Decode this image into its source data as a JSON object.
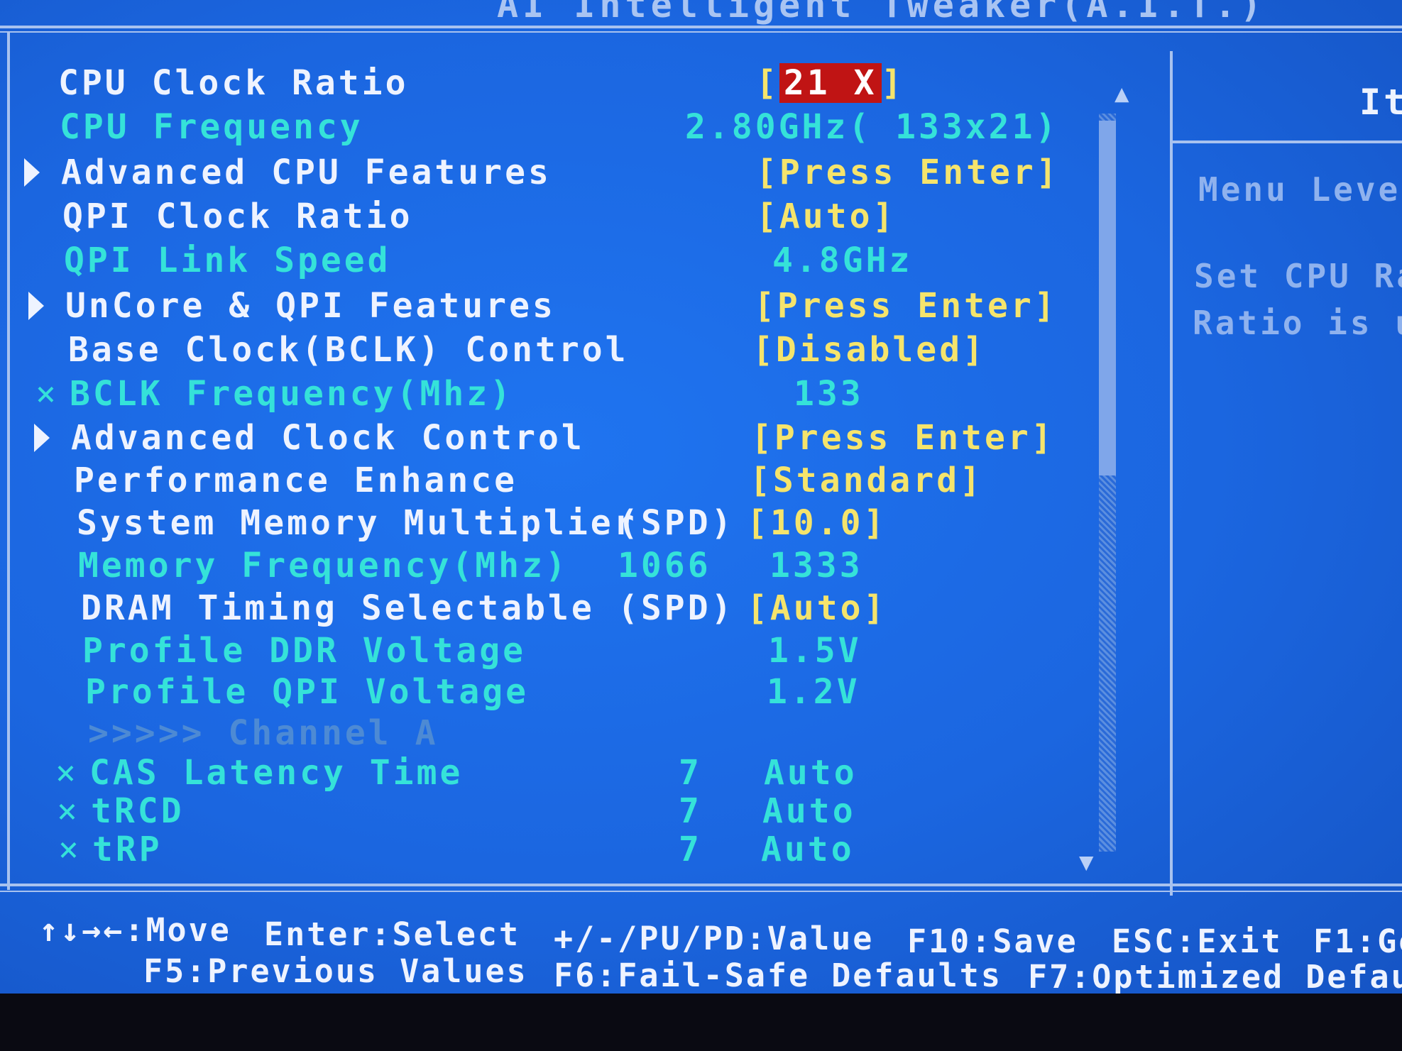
{
  "title": "AI Intelligent Tweaker(A.I.T.)",
  "settings": [
    {
      "label": "CPU Clock Ratio",
      "value": "21 X",
      "type": "selected"
    },
    {
      "label": "CPU Frequency",
      "value": "2.80GHz( 133x21)",
      "type": "info"
    },
    {
      "label": "Advanced CPU Features",
      "value": "[Press Enter]",
      "type": "submenu"
    },
    {
      "label": "QPI Clock Ratio",
      "value": "[Auto]",
      "type": "option"
    },
    {
      "label": "QPI Link Speed",
      "value": "4.8GHz",
      "type": "info"
    },
    {
      "label": "UnCore & QPI Features",
      "value": "[Press Enter]",
      "type": "submenu"
    },
    {
      "label": "Base Clock(BCLK) Control",
      "value": "[Disabled]",
      "type": "option"
    },
    {
      "label": "BCLK Frequency(Mhz)",
      "value": "133",
      "type": "disabled"
    },
    {
      "label": "Advanced Clock Control",
      "value": "[Press Enter]",
      "type": "submenu"
    },
    {
      "label": "Performance Enhance",
      "value": "[Standard]",
      "type": "option"
    },
    {
      "label": "System Memory Multiplier",
      "mid": "(SPD)",
      "value": "[10.0]",
      "type": "option"
    },
    {
      "label": "Memory Frequency(Mhz)",
      "mid": "1066",
      "value": "1333",
      "type": "info"
    },
    {
      "label": "DRAM Timing Selectable",
      "mid": "(SPD)",
      "value": "[Auto]",
      "type": "option"
    },
    {
      "label": "Profile DDR Voltage",
      "value": "1.5V",
      "type": "info"
    },
    {
      "label": "Profile QPI Voltage",
      "value": "1.2V",
      "type": "info"
    },
    {
      "label": ">>>>> Channel A",
      "value": "",
      "type": "header"
    },
    {
      "label": "CAS Latency Time",
      "mid": "7",
      "value": "Auto",
      "type": "disabled"
    },
    {
      "label": "tRCD",
      "mid": "7",
      "value": "Auto",
      "type": "disabled"
    },
    {
      "label": "tRP",
      "mid": "7",
      "value": "Auto",
      "type": "disabled"
    }
  ],
  "selected_left": "[",
  "selected_right": "]",
  "disabled_mark": "×",
  "help": {
    "title": "It",
    "lines": [
      "Menu Leve",
      "Set CPU Ra",
      "Ratio is u"
    ]
  },
  "footer": {
    "move": "↑↓→←:Move",
    "select": "Enter:Select",
    "value": "+/-/PU/PD:Value",
    "save": "F10:Save",
    "exit": "ESC:Exit",
    "general": "F1:Ge",
    "previous": "F5:Previous Values",
    "failsafe": "F6:Fail-Safe Defaults",
    "optimized": "F7:Optimized Defau"
  },
  "colors": {
    "background": "#1b66e0",
    "label": "#eef3ff",
    "info": "#35e2d9",
    "value": "#f5e46c",
    "selected": "#c01414"
  }
}
